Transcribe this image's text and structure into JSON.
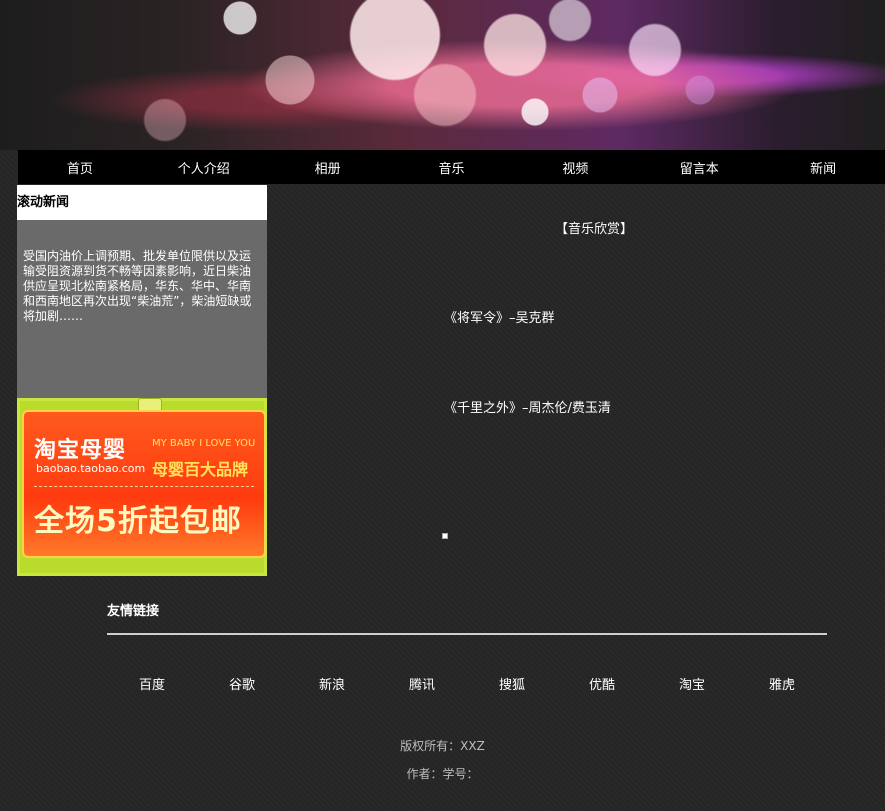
{
  "nav": {
    "items": [
      "首页",
      "个人介绍",
      "相册",
      "音乐",
      "视频",
      "留言本",
      "新闻"
    ]
  },
  "sidebar": {
    "title": "滚动新闻",
    "news_text": "受国内油价上调预期、批发单位限供以及运输受阻资源到货不畅等因素影响，近日柴油供应呈现北松南紧格局，华东、华中、华南和西南地区再次出现“柴油荒”，柴油短缺或将加剧……"
  },
  "ad": {
    "logo": "淘宝母婴",
    "url": "baobao.taobao.com",
    "slogan_en": "MY BABY I LOVE YOU",
    "slogan_cn": "母婴百大品牌",
    "promo": "全场5折起包邮"
  },
  "main": {
    "title": "【音乐欣赏】",
    "songs": [
      "《将军令》–吴克群",
      "《千里之外》–周杰伦/费玉清"
    ]
  },
  "links": {
    "title": "友情链接",
    "items": [
      "百度",
      "谷歌",
      "新浪",
      "腾讯",
      "搜狐",
      "优酷",
      "淘宝",
      "雅虎"
    ]
  },
  "footer": {
    "copyright": "版权所有：XXZ",
    "author": "作者：学号："
  }
}
